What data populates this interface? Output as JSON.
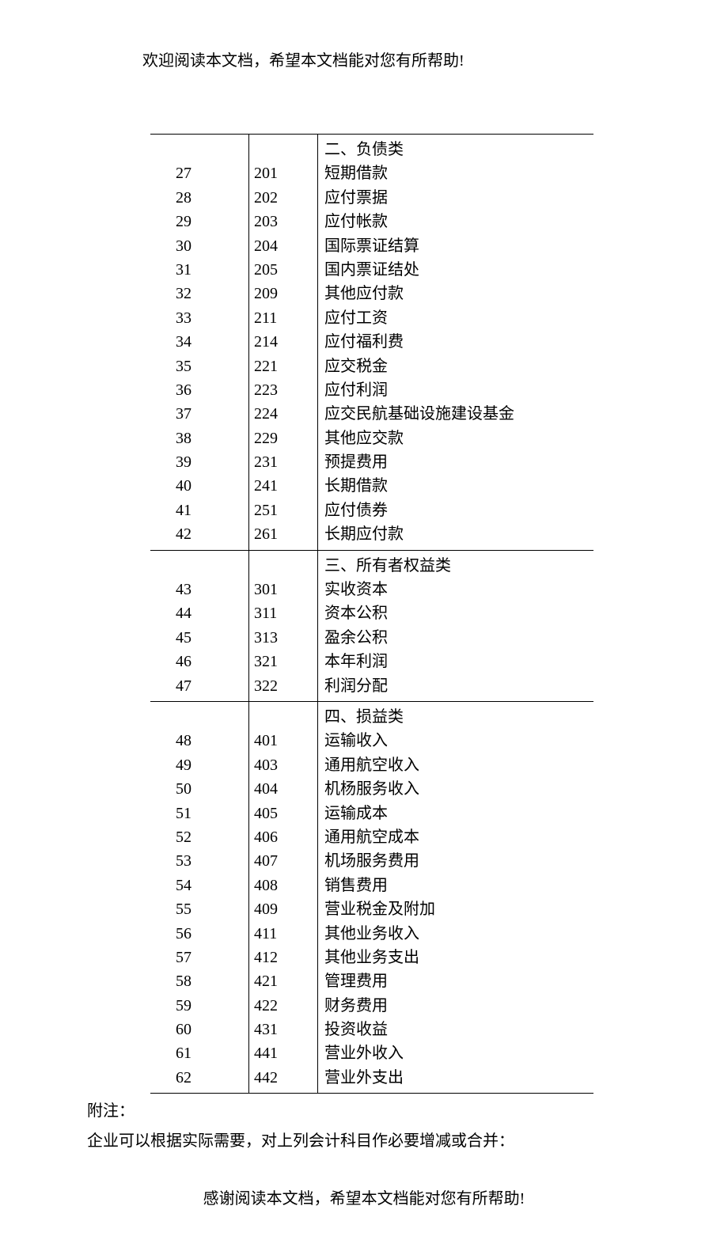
{
  "header": "欢迎阅读本文档，希望本文档能对您有所帮助!",
  "footer": "感谢阅读本文档，希望本文档能对您有所帮助!",
  "notes": [
    "附注：",
    "企业可以根据实际需要，对上列会计科目作必要增减或合并："
  ],
  "sections": [
    {
      "header": "二、负债类",
      "seq": [
        "27",
        "28",
        "29",
        "30",
        "31",
        "32",
        "33",
        "34",
        "35",
        "36",
        "37",
        "38",
        "39",
        "40",
        "41",
        "42"
      ],
      "codes": [
        "201",
        "202",
        "203",
        "204",
        "205",
        "209",
        "211",
        "214",
        "221",
        "223",
        "224",
        "229",
        "231",
        "241",
        "251",
        "261"
      ],
      "names": [
        "短期借款",
        "应付票据",
        "应付帐款",
        "国际票证结算",
        "国内票证结处",
        "其他应付款",
        "应付工资",
        "应付福利费",
        "应交税金",
        "应付利润",
        "应交民航基础设施建设基金",
        "其他应交款",
        "预提费用",
        "长期借款",
        "应付债券",
        "长期应付款"
      ]
    },
    {
      "header": "三、所有者权益类",
      "seq": [
        "43",
        "44",
        "45",
        "46",
        "47"
      ],
      "codes": [
        "301",
        "311",
        "313",
        "321",
        "322"
      ],
      "names": [
        "实收资本",
        "资本公积",
        "盈余公积",
        "本年利润",
        "利润分配"
      ]
    },
    {
      "header": "四、损益类",
      "seq": [
        "48",
        "49",
        "50",
        "51",
        "52",
        "53",
        "54",
        "55",
        "56",
        "57",
        "58",
        "59",
        "60",
        "61",
        "62"
      ],
      "codes": [
        "401",
        "403",
        "404",
        "405",
        "406",
        "407",
        "408",
        "409",
        "411",
        "412",
        "421",
        "422",
        "431",
        "441",
        "442"
      ],
      "names": [
        "运输收入",
        "通用航空收入",
        "机杨服务收入",
        "运输成本",
        "通用航空成本",
        "机场服务费用",
        "销售费用",
        "营业税金及附加",
        "其他业务收入",
        "其他业务支出",
        "管理费用",
        "财务费用",
        "投资收益",
        "营业外收入",
        "营业外支出"
      ]
    }
  ]
}
